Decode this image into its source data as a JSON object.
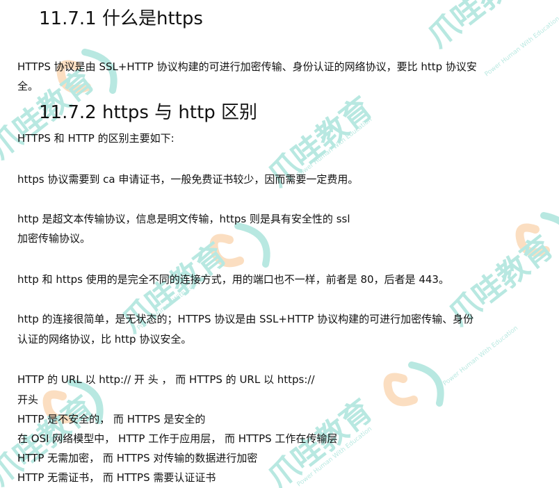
{
  "sections": [
    {
      "heading": "11.7.1 什么是https",
      "paragraph_lines": [
        "HTTPS 协议是由 SSL+HTTP 协议构建的可进行加密传输、身份认证的网络协议，要比 http 协议安",
        "全。"
      ]
    },
    {
      "heading": "11.7.2 https 与 http 区别",
      "intro": "HTTPS 和 HTTP 的区别主要如下:",
      "items": [
        {
          "lines": [
            "https 协议需要到 ca 申请证书，一般免费证书较少，因而需要一定费用。"
          ]
        },
        {
          "lines": [
            "http 是超文本传输协议，信息是明文传输，https 则是具有安全性的 ssl",
            "加密传输协议。"
          ]
        },
        {
          "lines": [
            "http 和 https 使用的是完全不同的连接方式，用的端口也不一样，前者是 80，后者是 443。"
          ]
        },
        {
          "lines": [
            "http 的连接很简单，是无状态的；HTTPS 协议是由 SSL+HTTP 协议构建的可进行加密传输、身份",
            "认证的网络协议，比 http 协议安全。"
          ]
        }
      ],
      "comparison_lines": [
        "HTTP 的 URL 以 http:// 开 头 ， 而 HTTPS 的 URL 以 https://",
        "开头",
        "HTTP 是不安全的， 而 HTTPS 是安全的",
        "在 OSI 网络模型中， HTTP 工作于应用层， 而 HTTPS 工作在传输层",
        "HTTP 无需加密， 而 HTTPS 对传输的数据进行加密",
        "HTTP 无需证书， 而 HTTPS 需要认证证书"
      ]
    }
  ],
  "watermark": {
    "brand": "爪哇教育",
    "tagline": "Power Human With Education",
    "colors": {
      "teal": "#7fd6c8",
      "orange": "#f7c48e"
    }
  }
}
